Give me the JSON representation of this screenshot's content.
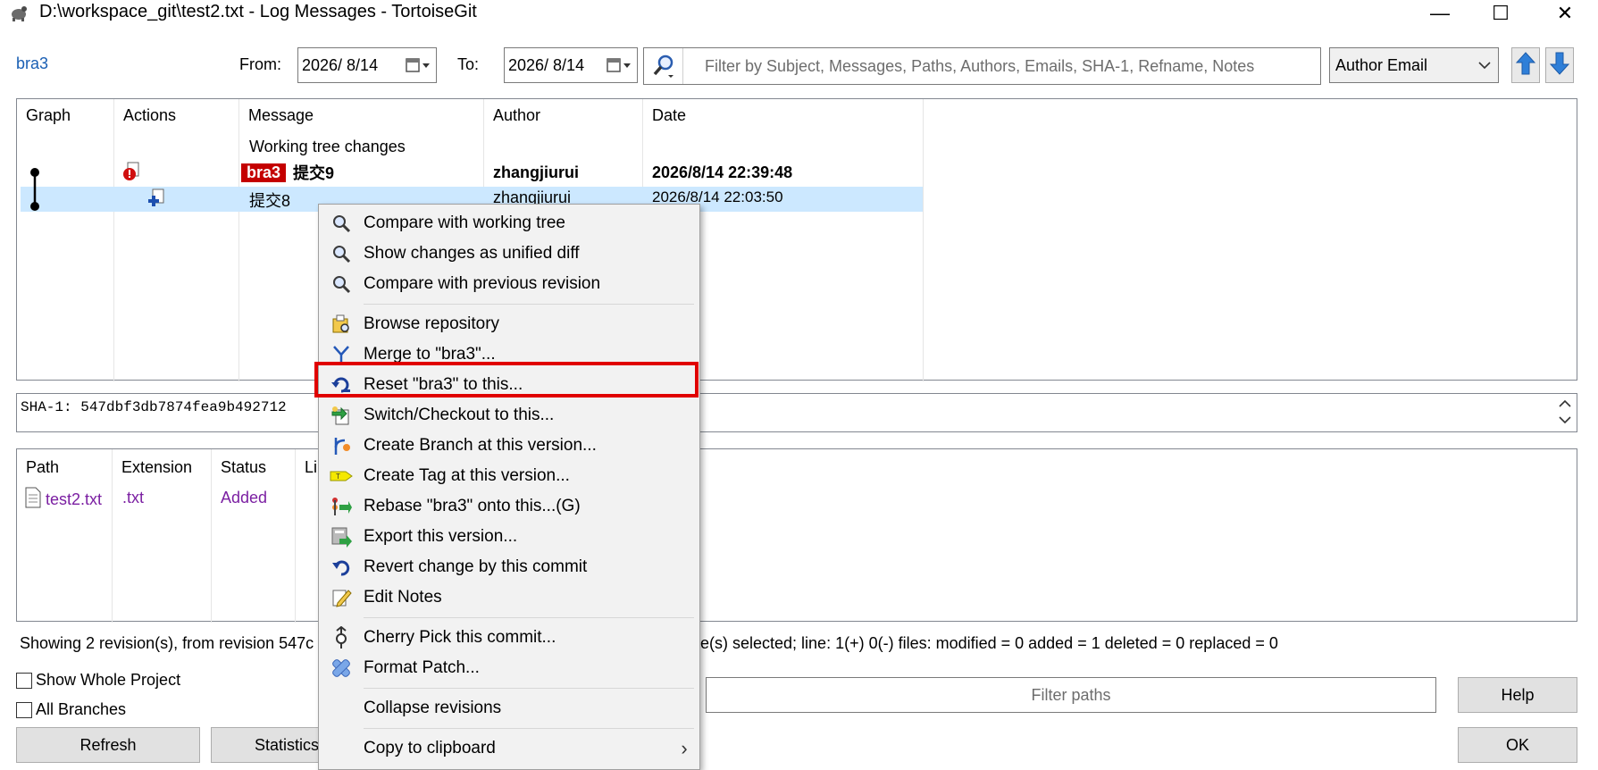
{
  "window": {
    "title": "D:\\workspace_git\\test2.txt - Log Messages - TortoiseGit",
    "minimize": "—",
    "maximize": "☐",
    "close": "✕"
  },
  "toolbar": {
    "branch": "bra3",
    "from_label": "From:",
    "from_date": "2026/  8/14",
    "to_label": "To:",
    "to_date": "2026/  8/14",
    "filter_placeholder": "Filter by Subject, Messages, Paths, Authors, Emails, SHA-1, Refname, Notes",
    "filter_field": "Author Email"
  },
  "log": {
    "columns": [
      "Graph",
      "Actions",
      "Message",
      "Author",
      "Date"
    ],
    "working_tree": "Working tree changes",
    "rows": [
      {
        "branch": "bra3",
        "message": "提交9",
        "author": "zhangjiurui",
        "date": "2026/8/14 22:39:48"
      },
      {
        "message": "提交8",
        "author": "zhangjiurui",
        "date": "2026/8/14 22:03:50"
      }
    ]
  },
  "sha": {
    "text": "SHA-1: 547dbf3db7874fea9b492712"
  },
  "files": {
    "columns": [
      "Path",
      "Extension",
      "Status",
      "Li"
    ],
    "rows": [
      {
        "path": "test2.txt",
        "extension": ".txt",
        "status": "Added"
      }
    ]
  },
  "status": {
    "left": "Showing 2 revision(s), from revision 547c",
    "right": "ile(s) selected; line: 1(+) 0(-) files: modified = 0 added = 1 deleted = 0 replaced = 0"
  },
  "bottom": {
    "show_whole_project": "Show Whole Project",
    "all_branches": "All Branches",
    "refresh": "Refresh",
    "statistics": "Statistics",
    "filter_paths_placeholder": "Filter paths",
    "help": "Help",
    "ok": "OK"
  },
  "context_menu": {
    "items": [
      {
        "label": "Compare with working tree",
        "icon": "magnifier-icon"
      },
      {
        "label": "Show changes as unified diff",
        "icon": "magnifier-icon"
      },
      {
        "label": "Compare with previous revision",
        "icon": "magnifier-icon"
      },
      {
        "label": "Browse repository",
        "icon": "repo-browser-icon"
      },
      {
        "label": "Merge to \"bra3\"...",
        "icon": "merge-icon"
      },
      {
        "label": "Reset \"bra3\" to this...",
        "icon": "reset-icon"
      },
      {
        "label": "Switch/Checkout to this...",
        "icon": "switch-icon"
      },
      {
        "label": "Create Branch at this version...",
        "icon": "branch-icon"
      },
      {
        "label": "Create Tag at this version...",
        "icon": "tag-icon"
      },
      {
        "label": "Rebase \"bra3\" onto this...(G)",
        "icon": "rebase-icon"
      },
      {
        "label": "Export this version...",
        "icon": "export-icon"
      },
      {
        "label": "Revert change by this commit",
        "icon": "revert-icon"
      },
      {
        "label": "Edit Notes",
        "icon": "edit-notes-icon"
      },
      {
        "label": "Cherry Pick this commit...",
        "icon": "cherry-pick-icon"
      },
      {
        "label": "Format Patch...",
        "icon": "patch-icon"
      },
      {
        "label": "Collapse revisions",
        "icon": ""
      },
      {
        "label": "Copy to clipboard",
        "icon": ""
      }
    ],
    "submenu_arrow": "›"
  },
  "colors": {
    "accent": "#1a5fb4",
    "selection": "#cce8ff",
    "branch_tag": "#c40000",
    "highlight": "#e00000",
    "added": "#7b1fa2"
  }
}
